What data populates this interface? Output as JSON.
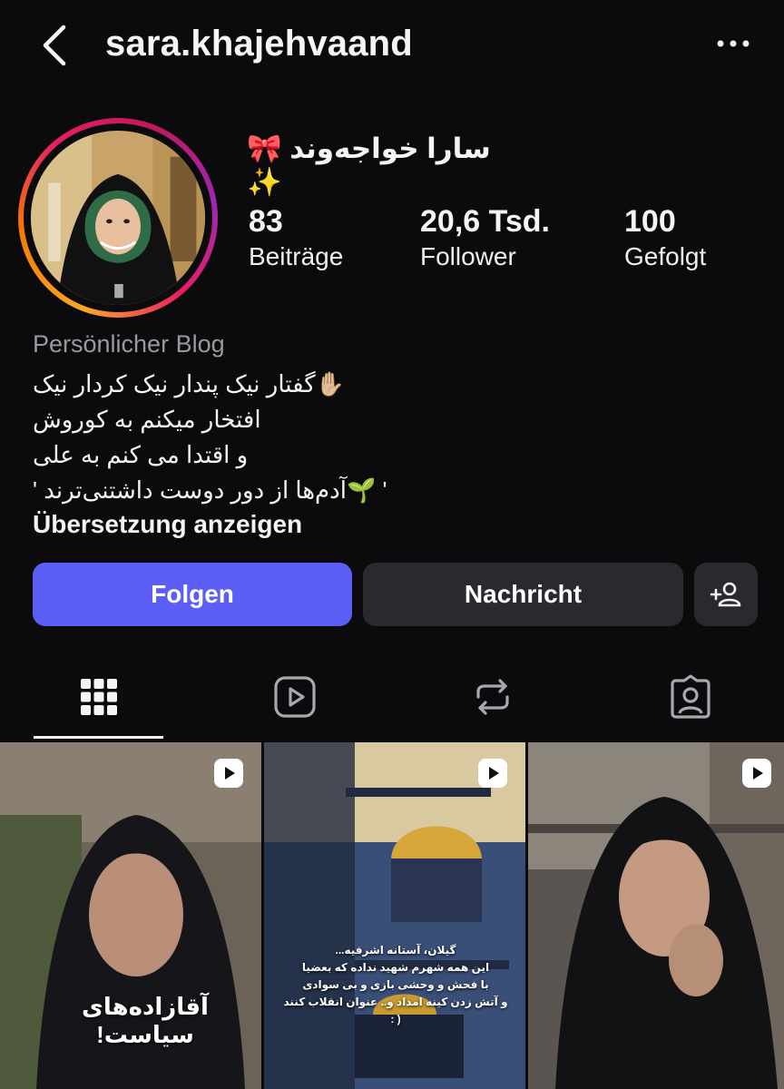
{
  "header": {
    "username": "sara.khajehvaand"
  },
  "profile": {
    "display_name": "سارا خواجه‌وند 🎀✨",
    "stats": {
      "posts": {
        "count": "83",
        "label": "Beiträge"
      },
      "followers": {
        "count": "20,6 Tsd.",
        "label": "Follower"
      },
      "following": {
        "count": "100",
        "label": "Gefolgt"
      }
    },
    "category": "Persönlicher Blog",
    "bio_lines": [
      "✋🏼گفتار نیک پندار نیک کردار نیک",
      "افتخار میکنم به کوروش",
      "و اقتدا می کنم به علی",
      "' 🌱آدم‌ها از دور دوست داشتنی‌ترند '"
    ],
    "translate_label": "Übersetzung anzeigen"
  },
  "actions": {
    "follow_label": "Folgen",
    "message_label": "Nachricht"
  },
  "tabs": [
    {
      "icon": "grid-icon",
      "active": true
    },
    {
      "icon": "reels-icon",
      "active": false
    },
    {
      "icon": "repost-icon",
      "active": false
    },
    {
      "icon": "tagged-icon",
      "active": false
    }
  ],
  "posts": [
    {
      "type": "reel",
      "caption": "آقازاده‌های سیاست!"
    },
    {
      "type": "reel",
      "caption_lines": [
        "گیلان، آستانه اشرفیه...",
        "این همه شهرم شهید نداده که بعضیا",
        "با فحش و وحشی بازی و بی سوادی",
        "و آتش زدن کینه امداد و.. عنوان انقلاب کنند ( :"
      ]
    },
    {
      "type": "reel"
    }
  ],
  "colors": {
    "background": "#0b0b0d",
    "follow_button": "#5b5ff6",
    "secondary_button": "#2a2a2e",
    "muted_text": "#9a9a9e"
  }
}
